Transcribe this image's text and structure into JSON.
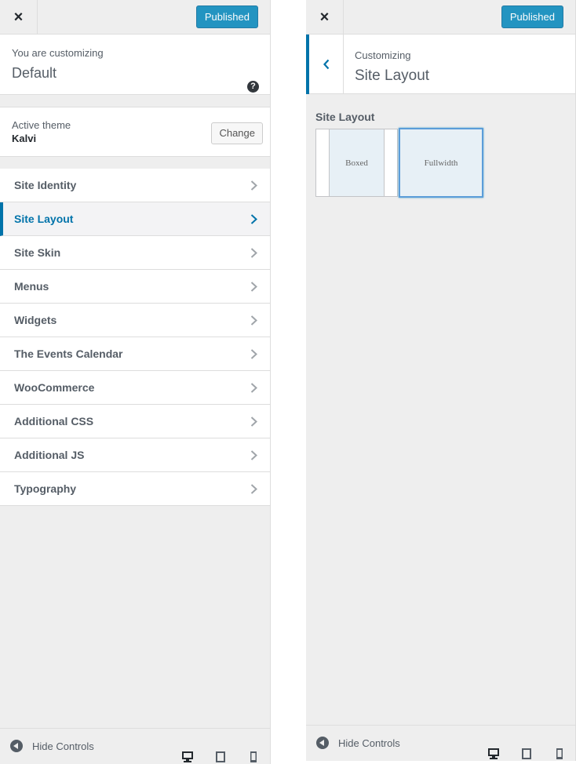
{
  "left_panel": {
    "close_icon": "×",
    "publish_label": "Published",
    "customizing_label": "You are customizing",
    "site_title": "Default",
    "help_icon": "?",
    "theme": {
      "label": "Active theme",
      "name": "Kalvi",
      "change_label": "Change"
    },
    "menu": [
      {
        "label": "Site Identity",
        "active": false
      },
      {
        "label": "Site Layout",
        "active": true
      },
      {
        "label": "Site Skin",
        "active": false
      },
      {
        "label": "Menus",
        "active": false
      },
      {
        "label": "Widgets",
        "active": false
      },
      {
        "label": "The Events Calendar",
        "active": false
      },
      {
        "label": "WooCommerce",
        "active": false
      },
      {
        "label": "Additional CSS",
        "active": false
      },
      {
        "label": "Additional JS",
        "active": false
      },
      {
        "label": "Typography",
        "active": false
      }
    ],
    "footer": {
      "hide_controls": "Hide Controls",
      "devices": [
        "desktop-icon",
        "tablet-icon",
        "mobile-icon"
      ]
    }
  },
  "right_panel": {
    "close_icon": "×",
    "publish_label": "Published",
    "section_small": "Customizing",
    "section_title": "Site Layout",
    "control_title": "Site Layout",
    "options": [
      {
        "label": "Boxed",
        "selected": false
      },
      {
        "label": "Fullwidth",
        "selected": true
      }
    ],
    "footer": {
      "hide_controls": "Hide Controls"
    }
  },
  "colors": {
    "accent": "#0073aa",
    "publish": "#0085ba",
    "panel_bg": "#eeeeee"
  }
}
